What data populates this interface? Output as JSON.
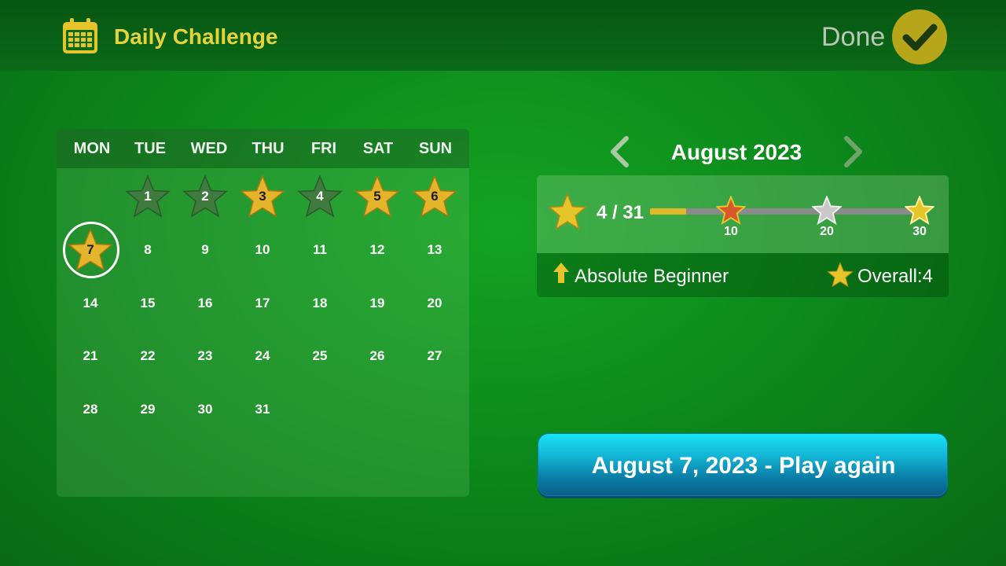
{
  "header": {
    "title": "Daily Challenge",
    "done_label": "Done",
    "title_color": "#e6d33a",
    "done_button_color": "#b7a51a"
  },
  "calendar": {
    "weekdays": [
      "MON",
      "TUE",
      "WED",
      "THU",
      "FRI",
      "SAT",
      "SUN"
    ],
    "days": [
      {
        "num": "1",
        "star": "earned-dim"
      },
      {
        "num": "2",
        "star": "earned-dim"
      },
      {
        "num": "3",
        "star": "gold"
      },
      {
        "num": "4",
        "star": "earned-dim"
      },
      {
        "num": "5",
        "star": "gold"
      },
      {
        "num": "6",
        "star": "gold"
      },
      {
        "num": "7",
        "star": "gold",
        "selected": true
      },
      {
        "num": "8"
      },
      {
        "num": "9"
      },
      {
        "num": "10"
      },
      {
        "num": "11"
      },
      {
        "num": "12"
      },
      {
        "num": "13"
      },
      {
        "num": "14"
      },
      {
        "num": "15"
      },
      {
        "num": "16"
      },
      {
        "num": "17"
      },
      {
        "num": "18"
      },
      {
        "num": "19"
      },
      {
        "num": "20"
      },
      {
        "num": "21"
      },
      {
        "num": "22"
      },
      {
        "num": "23"
      },
      {
        "num": "24"
      },
      {
        "num": "25"
      },
      {
        "num": "26"
      },
      {
        "num": "27"
      },
      {
        "num": "28"
      },
      {
        "num": "29"
      },
      {
        "num": "30"
      },
      {
        "num": "31"
      }
    ],
    "first_weekday_index": 1
  },
  "month_nav": {
    "month_label": "August 2023",
    "prev_icon": "chevron-left-icon",
    "next_icon": "chevron-right-icon"
  },
  "progress": {
    "count_label": "4 / 31",
    "earned": 4,
    "total": 31,
    "milestones": [
      {
        "value": "10",
        "color": "#d9582a"
      },
      {
        "value": "20",
        "color": "#c8c8c8"
      },
      {
        "value": "30",
        "color": "#e6c52a"
      }
    ],
    "rank_label": "Absolute Beginner",
    "overall_label": "Overall:",
    "overall_value": "4"
  },
  "play_button": {
    "label": "August 7, 2023 - Play again"
  }
}
